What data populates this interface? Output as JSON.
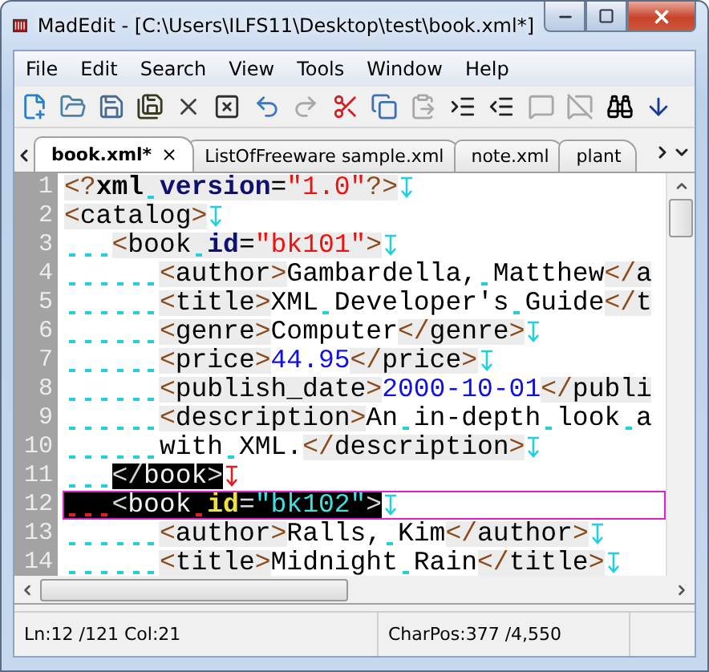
{
  "window": {
    "title": "MadEdit - [C:\\Users\\ILFS11\\Desktop\\test\\book.xml*]"
  },
  "menu": [
    "File",
    "Edit",
    "Search",
    "View",
    "Tools",
    "Window",
    "Help"
  ],
  "toolbar_groups": [
    [
      {
        "kind": "new-file",
        "disabled": false
      },
      {
        "kind": "open",
        "disabled": false
      },
      {
        "kind": "save",
        "disabled": false
      },
      {
        "kind": "save-all",
        "disabled": false
      },
      {
        "kind": "close",
        "disabled": false
      },
      {
        "kind": "close-all",
        "disabled": false
      }
    ],
    [
      {
        "kind": "undo",
        "disabled": false
      },
      {
        "kind": "redo",
        "disabled": true
      }
    ],
    [
      {
        "kind": "cut",
        "disabled": false
      },
      {
        "kind": "copy",
        "disabled": false
      },
      {
        "kind": "paste",
        "disabled": true
      }
    ],
    [
      {
        "kind": "indent",
        "disabled": false
      },
      {
        "kind": "outdent",
        "disabled": false
      }
    ],
    [
      {
        "kind": "comment",
        "disabled": true
      },
      {
        "kind": "uncomment",
        "disabled": true
      }
    ],
    [
      {
        "kind": "find",
        "disabled": false
      },
      {
        "kind": "find-next",
        "disabled": false
      }
    ]
  ],
  "tabs": [
    {
      "label": "book.xml*",
      "selected": true,
      "closable": true
    },
    {
      "label": "ListOfFreeware sample.xml",
      "selected": false,
      "closable": false
    },
    {
      "label": "note.xml",
      "selected": false,
      "closable": false
    },
    {
      "label": "plant",
      "selected": false,
      "closable": false
    }
  ],
  "lines": [
    {
      "number": "1",
      "eol": true,
      "bracket_match": false,
      "selected": false,
      "current": false,
      "tokens": [
        {
          "kind": "punct",
          "text": "<?"
        },
        {
          "kind": "decl",
          "text": "xml "
        },
        {
          "kind": "attr",
          "text": "version"
        },
        {
          "kind": "eq",
          "text": "="
        },
        {
          "kind": "string",
          "text": "\"1.0\""
        },
        {
          "kind": "punct",
          "text": "?>"
        }
      ]
    },
    {
      "number": "2",
      "eol": true,
      "bracket_match": false,
      "selected": false,
      "current": false,
      "tokens": [
        {
          "kind": "punct",
          "text": "<"
        },
        {
          "kind": "tag",
          "text": "catalog"
        },
        {
          "kind": "punct",
          "text": ">"
        }
      ]
    },
    {
      "number": "3",
      "eol": true,
      "bracket_match": false,
      "selected": false,
      "current": false,
      "tokens": [
        {
          "kind": "punct",
          "text": "   <"
        },
        {
          "kind": "tag",
          "text": "book "
        },
        {
          "kind": "attr",
          "text": "id"
        },
        {
          "kind": "eq",
          "text": "="
        },
        {
          "kind": "string",
          "text": "\"bk101\""
        },
        {
          "kind": "punct",
          "text": ">"
        }
      ]
    },
    {
      "number": "4",
      "eol": false,
      "bracket_match": false,
      "selected": false,
      "current": false,
      "tokens": [
        {
          "kind": "punct",
          "text": "      <"
        },
        {
          "kind": "tag",
          "text": "author"
        },
        {
          "kind": "punct",
          "text": ">"
        },
        {
          "kind": "text",
          "text": "Gambardella, Matthew"
        },
        {
          "kind": "punct",
          "text": "</"
        },
        {
          "kind": "tag",
          "text": "a"
        }
      ]
    },
    {
      "number": "5",
      "eol": false,
      "bracket_match": false,
      "selected": false,
      "current": false,
      "tokens": [
        {
          "kind": "punct",
          "text": "      <"
        },
        {
          "kind": "tag",
          "text": "title"
        },
        {
          "kind": "punct",
          "text": ">"
        },
        {
          "kind": "text",
          "text": "XML Developer's Guide"
        },
        {
          "kind": "punct",
          "text": "</"
        },
        {
          "kind": "tag",
          "text": "t"
        }
      ]
    },
    {
      "number": "6",
      "eol": true,
      "bracket_match": false,
      "selected": false,
      "current": false,
      "tokens": [
        {
          "kind": "punct",
          "text": "      <"
        },
        {
          "kind": "tag",
          "text": "genre"
        },
        {
          "kind": "punct",
          "text": ">"
        },
        {
          "kind": "text",
          "text": "Computer"
        },
        {
          "kind": "punct",
          "text": "</"
        },
        {
          "kind": "tag",
          "text": "genre"
        },
        {
          "kind": "punct",
          "text": ">"
        }
      ]
    },
    {
      "number": "7",
      "eol": true,
      "bracket_match": false,
      "selected": false,
      "current": false,
      "tokens": [
        {
          "kind": "punct",
          "text": "      <"
        },
        {
          "kind": "tag",
          "text": "price"
        },
        {
          "kind": "punct",
          "text": ">"
        },
        {
          "kind": "number",
          "text": "44.95"
        },
        {
          "kind": "punct",
          "text": "</"
        },
        {
          "kind": "tag",
          "text": "price"
        },
        {
          "kind": "punct",
          "text": ">"
        }
      ]
    },
    {
      "number": "8",
      "eol": false,
      "bracket_match": false,
      "selected": false,
      "current": false,
      "tokens": [
        {
          "kind": "punct",
          "text": "      <"
        },
        {
          "kind": "tag",
          "text": "publish_date"
        },
        {
          "kind": "punct",
          "text": ">"
        },
        {
          "kind": "number",
          "text": "2000-10-01"
        },
        {
          "kind": "punct",
          "text": "</"
        },
        {
          "kind": "tag",
          "text": "publi"
        }
      ]
    },
    {
      "number": "9",
      "eol": false,
      "bracket_match": false,
      "selected": false,
      "current": false,
      "tokens": [
        {
          "kind": "punct",
          "text": "      <"
        },
        {
          "kind": "tag",
          "text": "description"
        },
        {
          "kind": "punct",
          "text": ">"
        },
        {
          "kind": "text",
          "text": "An in-depth look a"
        }
      ]
    },
    {
      "number": "10",
      "eol": true,
      "bracket_match": false,
      "selected": false,
      "current": false,
      "tokens": [
        {
          "kind": "text",
          "text": "      with XML."
        },
        {
          "kind": "punct",
          "text": "</"
        },
        {
          "kind": "tag",
          "text": "description"
        },
        {
          "kind": "punct",
          "text": ">"
        }
      ]
    },
    {
      "number": "11",
      "eol": true,
      "bracket_match": true,
      "selected": false,
      "current": false,
      "tokens": [
        {
          "kind": "punct",
          "text": "   </"
        },
        {
          "kind": "tag",
          "text": "book"
        },
        {
          "kind": "punct",
          "text": ">"
        }
      ]
    },
    {
      "number": "12",
      "eol": true,
      "bracket_match": false,
      "selected": true,
      "current": true,
      "tokens": [
        {
          "kind": "punct",
          "text": "   <"
        },
        {
          "kind": "tag",
          "text": "book "
        },
        {
          "kind": "attr",
          "text": "id"
        },
        {
          "kind": "eq",
          "text": "="
        },
        {
          "kind": "string",
          "text": "\"bk102\""
        },
        {
          "kind": "punct",
          "text": ">"
        }
      ]
    },
    {
      "number": "13",
      "eol": true,
      "bracket_match": false,
      "selected": false,
      "current": false,
      "tokens": [
        {
          "kind": "punct",
          "text": "      <"
        },
        {
          "kind": "tag",
          "text": "author"
        },
        {
          "kind": "punct",
          "text": ">"
        },
        {
          "kind": "text",
          "text": "Ralls, Kim"
        },
        {
          "kind": "punct",
          "text": "</"
        },
        {
          "kind": "tag",
          "text": "author"
        },
        {
          "kind": "punct",
          "text": ">"
        }
      ]
    },
    {
      "number": "14",
      "eol": true,
      "bracket_match": false,
      "selected": false,
      "current": false,
      "tokens": [
        {
          "kind": "punct",
          "text": "      <"
        },
        {
          "kind": "tag",
          "text": "title"
        },
        {
          "kind": "punct",
          "text": ">"
        },
        {
          "kind": "text",
          "text": "Midnight Rain"
        },
        {
          "kind": "punct",
          "text": "</"
        },
        {
          "kind": "tag",
          "text": "title"
        },
        {
          "kind": "punct",
          "text": ">"
        }
      ]
    }
  ],
  "status_bar": {
    "position": "Ln:12 /121 Col:21",
    "char_pos": "CharPos:377 /4,550"
  }
}
